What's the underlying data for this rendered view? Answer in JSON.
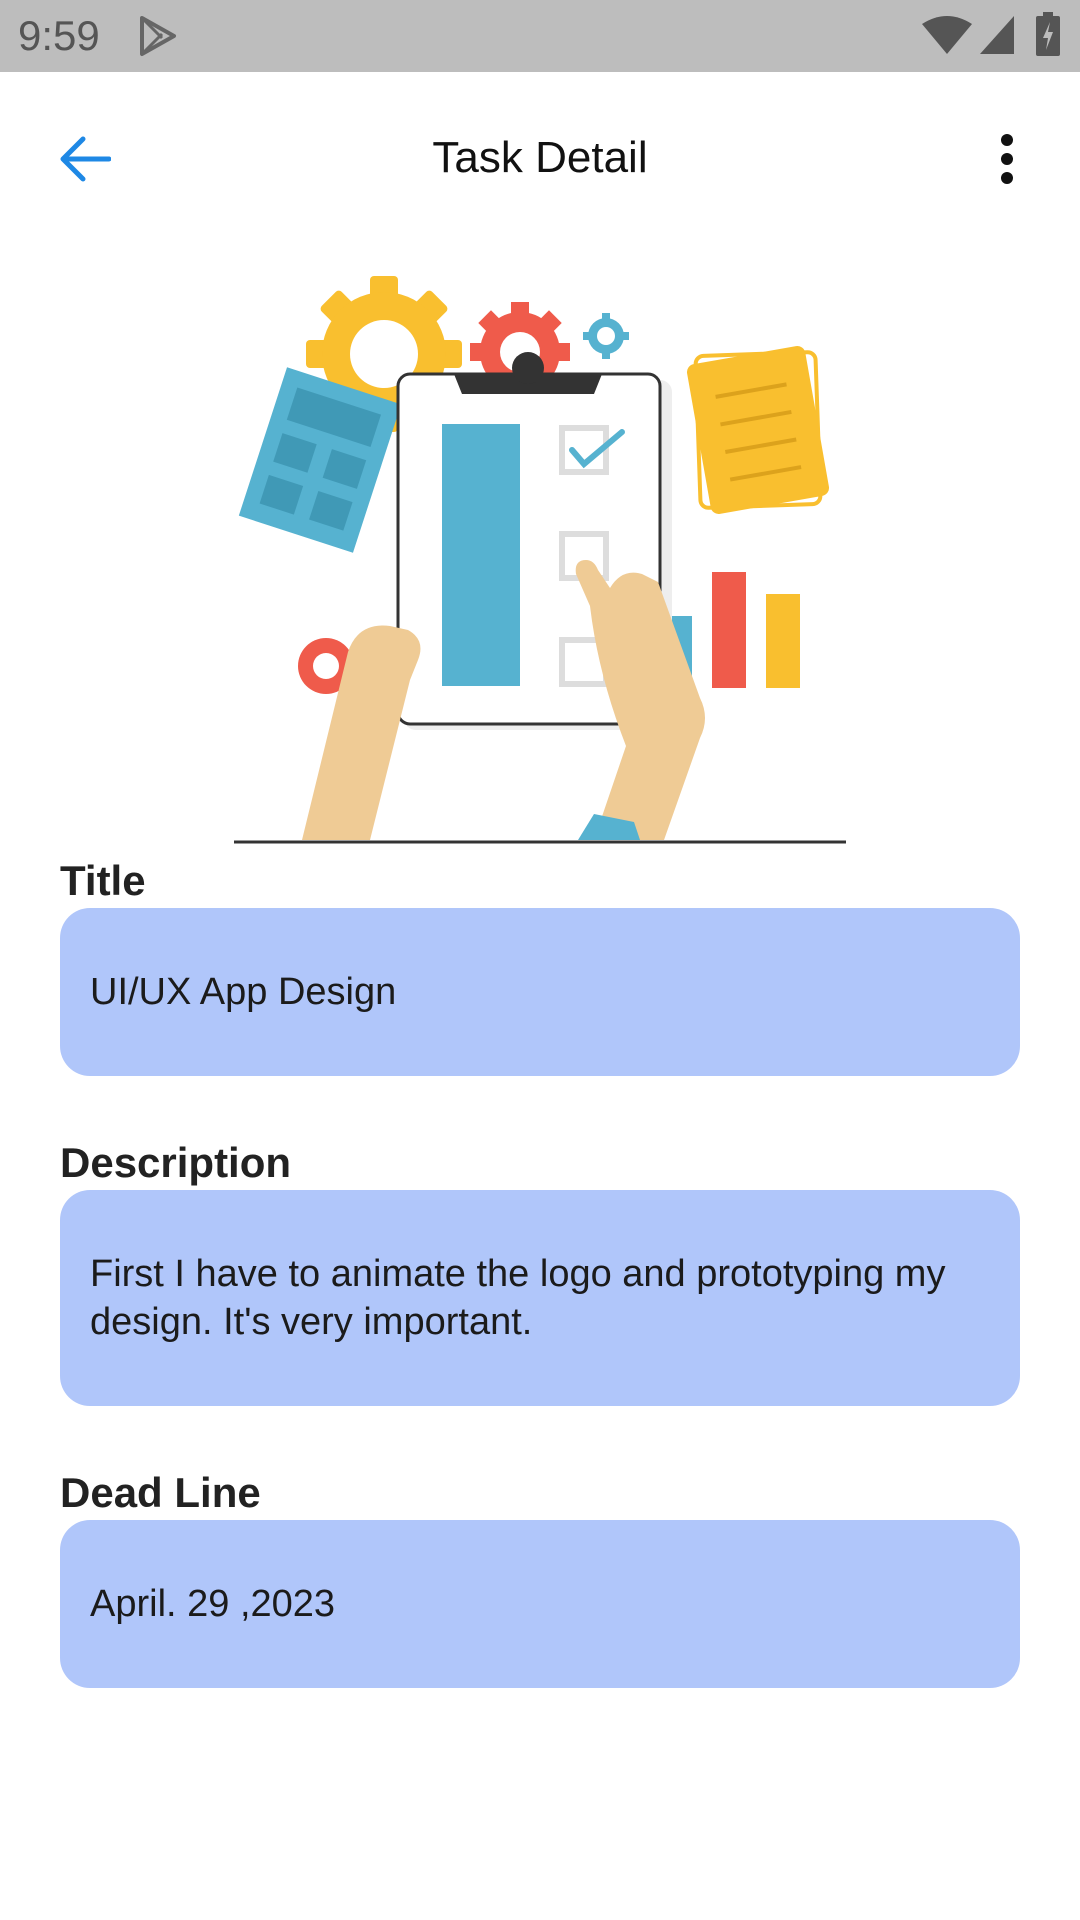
{
  "status_bar": {
    "time": "9:59",
    "icons": [
      "play-store-icon",
      "wifi-icon",
      "cell-signal-icon",
      "battery-charging-icon"
    ]
  },
  "app_bar": {
    "title": "Task Detail",
    "back_icon": "arrow-left-icon",
    "menu_icon": "more-vertical-icon",
    "accent_color": "#1e88e5"
  },
  "illustration": {
    "name": "task-checklist-illustration"
  },
  "fields": {
    "title": {
      "label": "Title",
      "value": "UI/UX App Design"
    },
    "description": {
      "label": "Description",
      "value": "First I have to animate the logo and prototyping my design. It's very important."
    },
    "deadline": {
      "label": "Dead Line",
      "value": "April. 29 ,2023"
    }
  },
  "colors": {
    "field_background": "#b0c6fa",
    "status_bar": "#bdbdbd",
    "page_background": "#ffffff"
  }
}
